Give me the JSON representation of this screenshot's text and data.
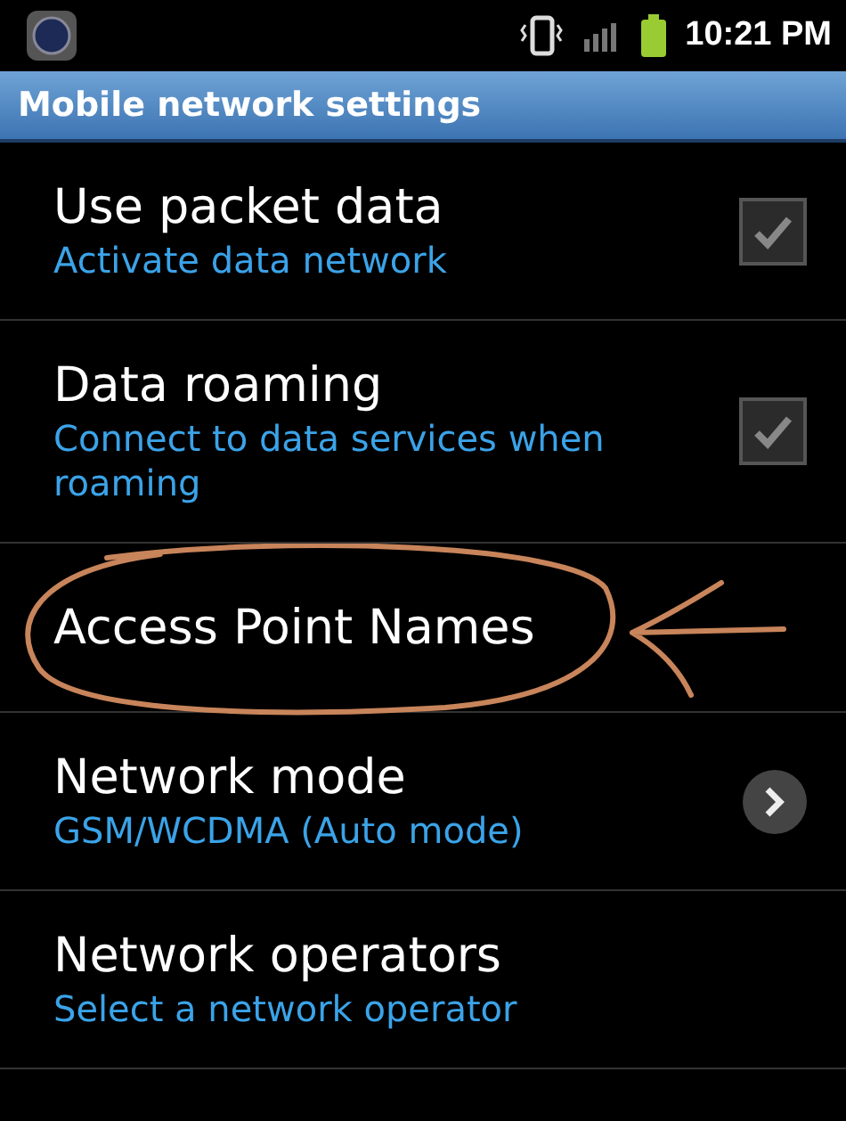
{
  "status_bar": {
    "time": "10:21 PM"
  },
  "title_bar": {
    "title": "Mobile network settings"
  },
  "settings": [
    {
      "kind": "checkbox",
      "title": "Use packet data",
      "summary": "Activate data network",
      "checked": true
    },
    {
      "kind": "checkbox",
      "title": "Data roaming",
      "summary": "Connect to data services when roaming",
      "checked": true
    },
    {
      "kind": "plain",
      "title": "Access Point Names",
      "annotated": true
    },
    {
      "kind": "chevron",
      "title": "Network mode",
      "summary": "GSM/WCDMA (Auto mode)"
    },
    {
      "kind": "plain",
      "title": "Network operators",
      "summary": "Select a network operator"
    }
  ]
}
